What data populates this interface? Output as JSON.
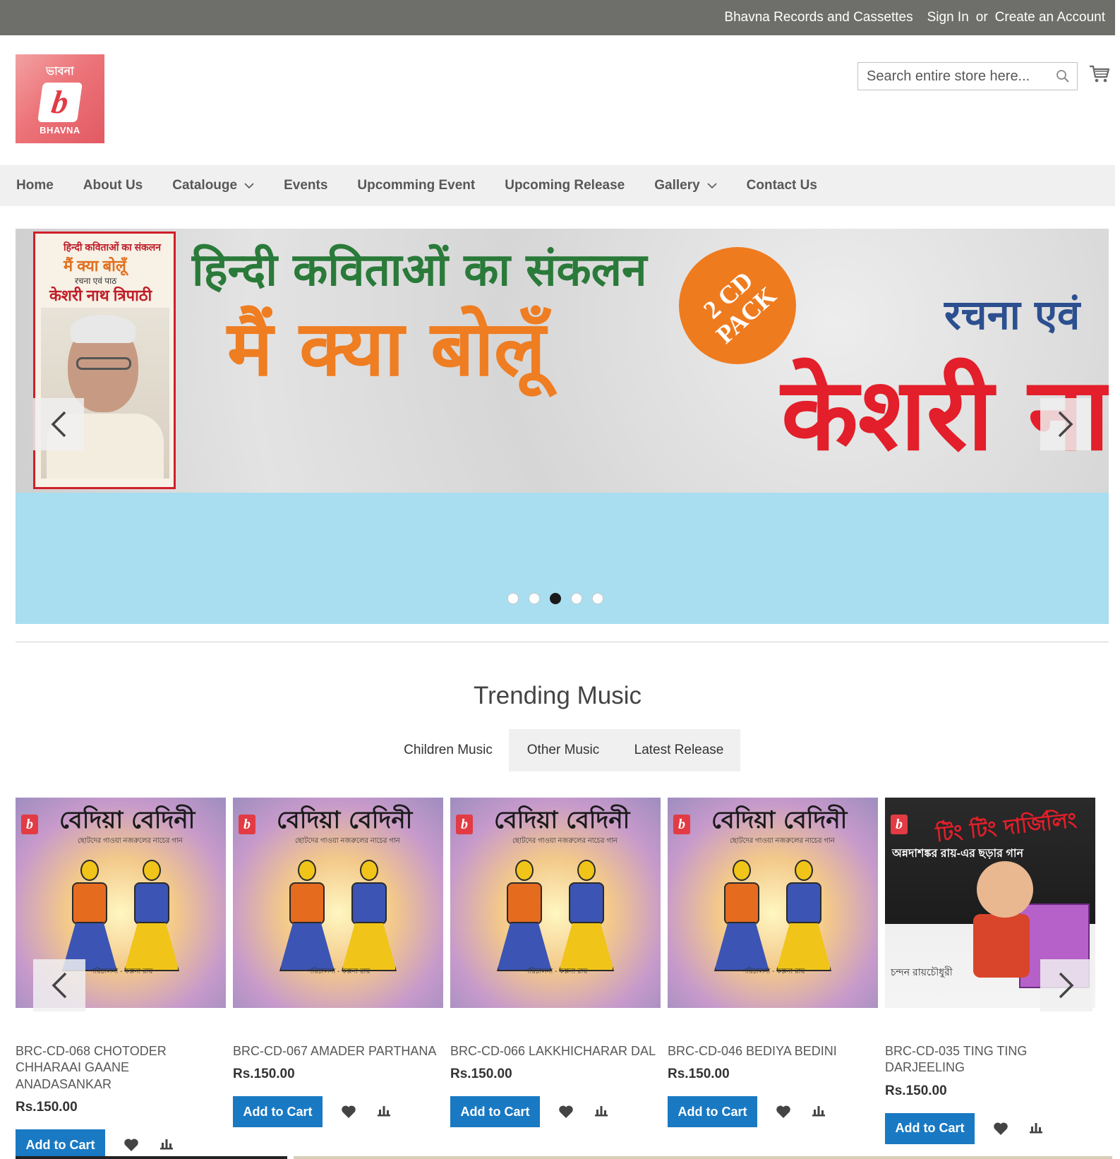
{
  "top_bar": {
    "welcome": "Bhavna Records and Cassettes",
    "sign_in": "Sign In",
    "or": "or",
    "create_account": "Create an Account"
  },
  "header": {
    "logo_top": "ভাবনা",
    "logo_mark": "b",
    "logo_bottom": "BHAVNA",
    "search_placeholder": "Search entire store here...",
    "search_icon": "search-icon",
    "cart_icon": "cart-icon"
  },
  "nav": {
    "items": [
      {
        "label": "Home"
      },
      {
        "label": "About Us"
      },
      {
        "label": "Catalouge",
        "has_dropdown": true
      },
      {
        "label": "Events"
      },
      {
        "label": "Upcomming Event"
      },
      {
        "label": "Upcoming Release"
      },
      {
        "label": "Gallery",
        "has_dropdown": true
      },
      {
        "label": "Contact Us"
      }
    ]
  },
  "banner": {
    "cover_line1": "हिन्दी कविताओं का संकलन",
    "cover_line2": "मैं क्या बोलूँ",
    "cover_line3": "रचना एवं पाठ",
    "cover_line4": "केशरी नाथ त्रिपाठी",
    "headline1": "हिन्दी कविताओं का संकलन",
    "headline2": "मैं क्या बोलूँ",
    "badge": "2 CD PACK",
    "headline3": "रचना एवं",
    "headline4": "केशरी नाथ",
    "slide_count": 5,
    "active_slide": 3
  },
  "section": {
    "title": "Trending Music",
    "tabs": [
      "Children Music",
      "Other Music",
      "Latest Release"
    ],
    "active_tab": 0
  },
  "products": [
    {
      "name": "BRC-CD-068 CHOTODER CHHARAAI GAANE ANADASANKAR",
      "price": "Rs.150.00",
      "cover": "bediya",
      "cover_title": "বেদিয়া বেদিনী"
    },
    {
      "name": "BRC-CD-067 AMADER PARTHANA",
      "price": "Rs.150.00",
      "cover": "bediya",
      "cover_title": "বেদিয়া বেদিনী"
    },
    {
      "name": "BRC-CD-066 LAKKHICHARAR DAL",
      "price": "Rs.150.00",
      "cover": "bediya",
      "cover_title": "বেদিয়া বেদিনী"
    },
    {
      "name": "BRC-CD-046 BEDIYA BEDINI",
      "price": "Rs.150.00",
      "cover": "bediya",
      "cover_title": "বেদিয়া বেদিনী"
    },
    {
      "name": "BRC-CD-035 TING TING DARJEELING",
      "price": "Rs.150.00",
      "cover": "ting",
      "cover_title": "টিং টিং দার্জিলিং"
    }
  ],
  "product_labels": {
    "add_to_cart": "Add to Cart",
    "wishlist_icon": "heart-icon",
    "compare_icon": "compare-icon"
  },
  "cover_texts": {
    "bediya_sub": "ছোটদের গাওয়া নজরুলের নাচের গান",
    "bediya_names": "পরিচালনা - কল্পনা রায়",
    "ting_sub": "অন্নদাশঙ্কর রায়-এর ছড়ার গান",
    "ting_credit": "চন্দন রায়চৌধুরী"
  },
  "colors": {
    "top_bar": "#6e6e6a",
    "nav_bg": "#f0f0f0",
    "button_blue": "#1979c3",
    "banner_bottom": "#a8def0"
  }
}
